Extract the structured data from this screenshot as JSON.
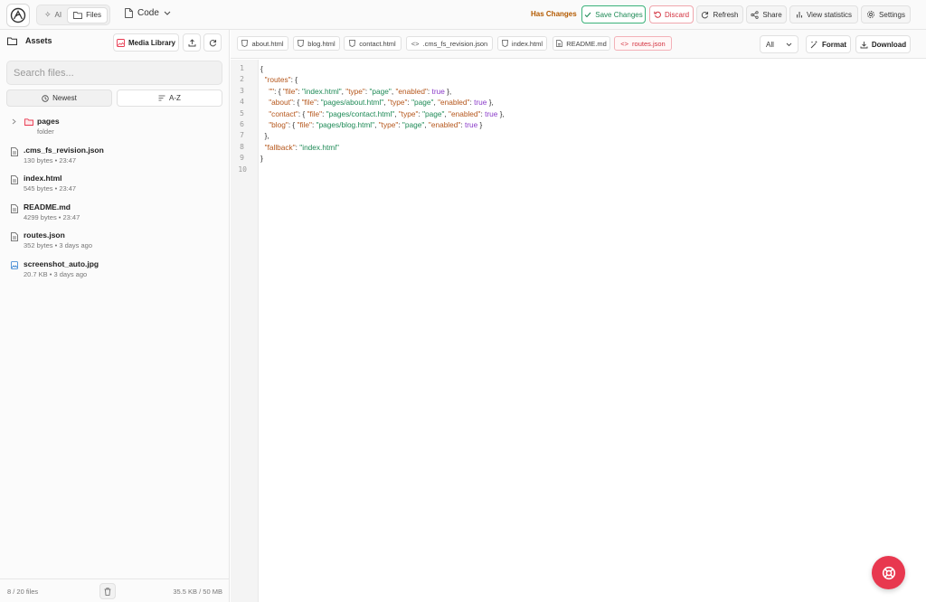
{
  "topbar": {
    "mode_ai": "AI",
    "mode_files": "Files",
    "code_menu": "Code",
    "has_changes": "Has Changes",
    "save": "Save Changes",
    "discard": "Discard",
    "refresh": "Refresh",
    "share": "Share",
    "view_statistics": "View statistics",
    "settings": "Settings"
  },
  "sidebar": {
    "title": "Assets",
    "media_library": "Media Library",
    "search_placeholder": "Search files...",
    "sort_newest": "Newest",
    "sort_az": "A-Z",
    "files": [
      {
        "name": "pages",
        "meta": "folder",
        "kind": "folder"
      },
      {
        "name": ".cms_fs_revision.json",
        "meta": "130 bytes • 23:47",
        "kind": "file"
      },
      {
        "name": "index.html",
        "meta": "545 bytes • 23:47",
        "kind": "file"
      },
      {
        "name": "README.md",
        "meta": "4299 bytes • 23:47",
        "kind": "file"
      },
      {
        "name": "routes.json",
        "meta": "352 bytes • 3 days ago",
        "kind": "file"
      },
      {
        "name": "screenshot_auto.jpg",
        "meta": "20.7 KB • 3 days ago",
        "kind": "image"
      }
    ],
    "file_count": "8 / 20 files",
    "usage": "35.5 KB / 50 MB"
  },
  "tabs": [
    {
      "label": "about.html",
      "icon": "html-file-icon"
    },
    {
      "label": "blog.html",
      "icon": "html-file-icon"
    },
    {
      "label": "contact.html",
      "icon": "html-file-icon"
    },
    {
      "label": ".cms_fs_revision.json",
      "icon": "code-icon"
    },
    {
      "label": "index.html",
      "icon": "html-file-icon"
    },
    {
      "label": "README.md",
      "icon": "document-icon"
    },
    {
      "label": "routes.json",
      "icon": "code-icon"
    }
  ],
  "active_tab": "routes.json",
  "toolbar": {
    "select_value": "All",
    "format": "Format",
    "download": "Download"
  },
  "editor": {
    "line_numbers": [
      "1",
      "2",
      "3",
      "4",
      "5",
      "6",
      "7",
      "8",
      "9",
      "10"
    ],
    "lines": [
      "{",
      "  \"routes\": {",
      "    \"\": { \"file\": \"index.html\", \"type\": \"page\", \"enabled\": true },",
      "    \"about\": { \"file\": \"pages/about.html\", \"type\": \"page\", \"enabled\": true },",
      "    \"contact\": { \"file\": \"pages/contact.html\", \"type\": \"page\", \"enabled\": true },",
      "    \"blog\": { \"file\": \"pages/blog.html\", \"type\": \"page\", \"enabled\": true }",
      "  },",
      "  \"fallback\": \"index.html\"",
      "}",
      ""
    ]
  },
  "colors": {
    "accent_red": "#e8384f",
    "save_green": "#1e8a56",
    "changes_orange": "#b35a00"
  }
}
